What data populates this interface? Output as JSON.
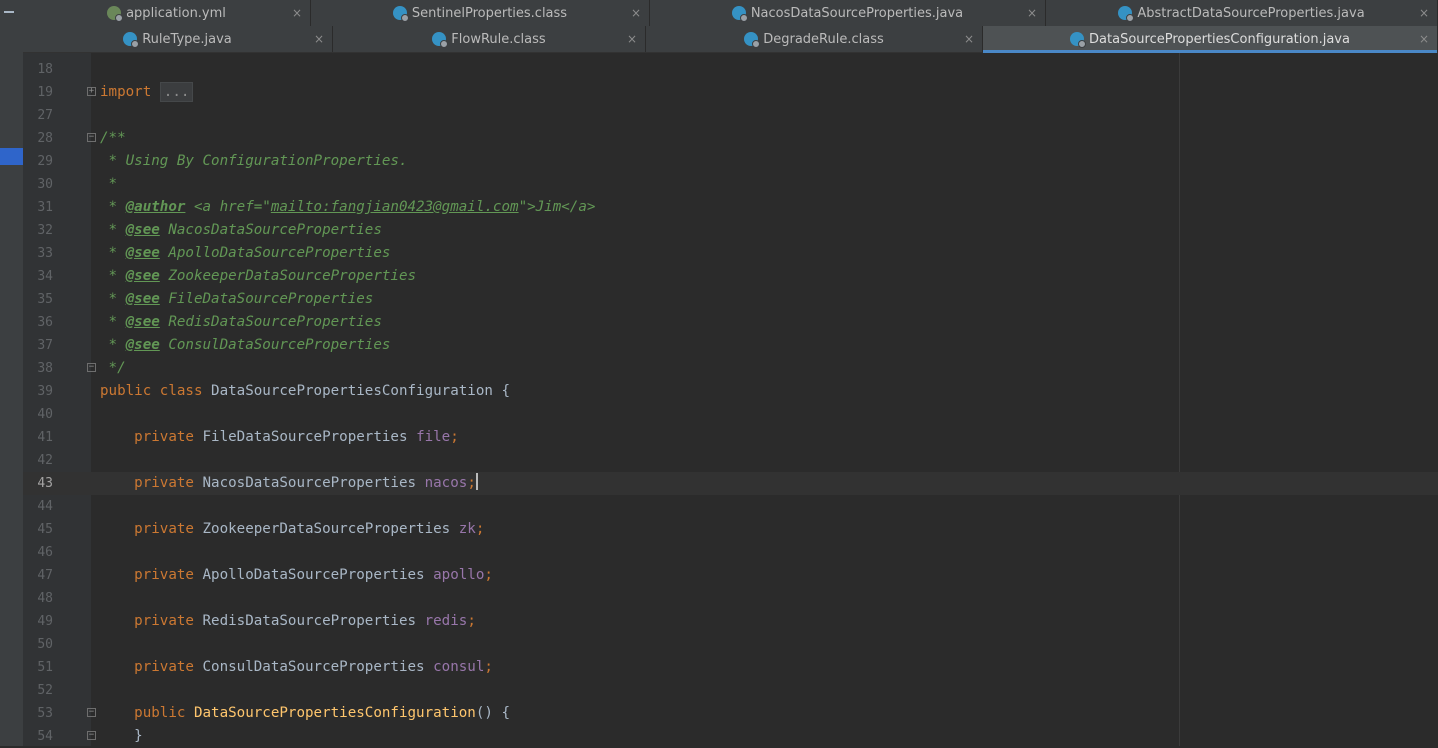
{
  "tabs_row_1": [
    {
      "name": "application.yml",
      "icon": "yml-icon"
    },
    {
      "name": "SentinelProperties.class",
      "icon": "class-icon"
    },
    {
      "name": "NacosDataSourceProperties.java",
      "icon": "class-icon"
    },
    {
      "name": "AbstractDataSourceProperties.java",
      "icon": "class-icon"
    }
  ],
  "tabs_row_2": [
    {
      "name": "RuleType.java",
      "icon": "class-icon"
    },
    {
      "name": "FlowRule.class",
      "icon": "class-icon"
    },
    {
      "name": "DegradeRule.class",
      "icon": "class-icon"
    },
    {
      "name": "DataSourcePropertiesConfiguration.java",
      "icon": "class-icon",
      "active": true
    }
  ],
  "close_glyph": "×",
  "editor": {
    "current_line": "43",
    "import_fold": "...",
    "lines": [
      {
        "n": "18"
      },
      {
        "n": "19",
        "kw": "import"
      },
      {
        "n": "27"
      },
      {
        "n": "28",
        "comment": "/**"
      },
      {
        "n": "29",
        "comment": " * Using By ConfigurationProperties."
      },
      {
        "n": "30",
        "comment": " *"
      },
      {
        "n": "31",
        "prefix": " * ",
        "tag": "@author",
        "text1": " <a href=\"",
        "link": "mailto:fangjian0423@gmail.com",
        "text2": "\">Jim</a>"
      },
      {
        "n": "32",
        "prefix": " * ",
        "tag": "@see",
        "text1": " NacosDataSourceProperties"
      },
      {
        "n": "33",
        "prefix": " * ",
        "tag": "@see",
        "text1": " ApolloDataSourceProperties"
      },
      {
        "n": "34",
        "prefix": " * ",
        "tag": "@see",
        "text1": " ZookeeperDataSourceProperties"
      },
      {
        "n": "35",
        "prefix": " * ",
        "tag": "@see",
        "text1": " FileDataSourceProperties"
      },
      {
        "n": "36",
        "prefix": " * ",
        "tag": "@see",
        "text1": " RedisDataSourceProperties"
      },
      {
        "n": "37",
        "prefix": " * ",
        "tag": "@see",
        "text1": " ConsulDataSourceProperties"
      },
      {
        "n": "38",
        "comment": " */"
      },
      {
        "n": "39",
        "kw": "public class",
        "name": " DataSourcePropertiesConfiguration {"
      },
      {
        "n": "40"
      },
      {
        "n": "41",
        "indent": "    ",
        "kw": "private",
        "type": " FileDataSourceProperties ",
        "field": "file",
        "semi": ";"
      },
      {
        "n": "42"
      },
      {
        "n": "43",
        "indent": "    ",
        "kw": "private",
        "type": " NacosDataSourceProperties ",
        "field": "nacos",
        "semi": ";"
      },
      {
        "n": "44"
      },
      {
        "n": "45",
        "indent": "    ",
        "kw": "private",
        "type": " ZookeeperDataSourceProperties ",
        "field": "zk",
        "semi": ";"
      },
      {
        "n": "46"
      },
      {
        "n": "47",
        "indent": "    ",
        "kw": "private",
        "type": " ApolloDataSourceProperties ",
        "field": "apollo",
        "semi": ";"
      },
      {
        "n": "48"
      },
      {
        "n": "49",
        "indent": "    ",
        "kw": "private",
        "type": " RedisDataSourceProperties ",
        "field": "redis",
        "semi": ";"
      },
      {
        "n": "50"
      },
      {
        "n": "51",
        "indent": "    ",
        "kw": "private",
        "type": " ConsulDataSourceProperties ",
        "field": "consul",
        "semi": ";"
      },
      {
        "n": "52"
      },
      {
        "n": "53",
        "indent": "    ",
        "kw": "public",
        "method": " DataSourcePropertiesConfiguration",
        "rest": "() {"
      },
      {
        "n": "54",
        "indent": "    ",
        "text": "}"
      }
    ]
  },
  "colors": {
    "keyword": "#cc7832",
    "comment": "#629755",
    "field": "#9876aa",
    "method": "#ffc66d",
    "text": "#a9b7c6",
    "accent": "#4a88c7"
  }
}
